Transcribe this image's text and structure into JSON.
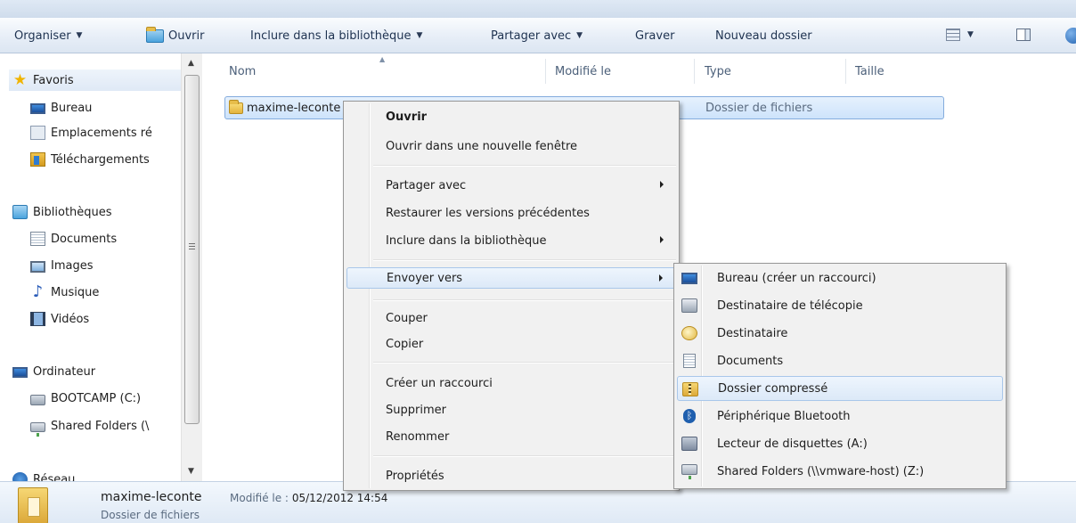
{
  "toolbar": {
    "organize": "Organiser",
    "open": "Ouvrir",
    "include_library": "Inclure dans la bibliothèque",
    "share_with": "Partager avec",
    "burn": "Graver",
    "new_folder": "Nouveau dossier"
  },
  "nav": {
    "favorites": "Favoris",
    "desktop": "Bureau",
    "recent_places": "Emplacements ré",
    "downloads": "Téléchargements",
    "libraries": "Bibliothèques",
    "documents": "Documents",
    "images": "Images",
    "music": "Musique",
    "videos": "Vidéos",
    "computer": "Ordinateur",
    "bootcamp": "BOOTCAMP (C:)",
    "shared_folders": "Shared Folders (\\",
    "network": "Réseau"
  },
  "columns": {
    "name": "Nom",
    "modified": "Modifié le",
    "type": "Type",
    "size": "Taille"
  },
  "file_row": {
    "name": "maxime-leconte",
    "type": "Dossier de fichiers"
  },
  "context_menu": {
    "open": "Ouvrir",
    "open_new_window": "Ouvrir dans une nouvelle fenêtre",
    "share_with": "Partager avec",
    "restore_versions": "Restaurer les versions précédentes",
    "include_library": "Inclure dans la bibliothèque",
    "send_to": "Envoyer vers",
    "cut": "Couper",
    "copy": "Copier",
    "create_shortcut": "Créer un raccourci",
    "delete": "Supprimer",
    "rename": "Renommer",
    "properties": "Propriétés"
  },
  "send_to_menu": {
    "desktop_shortcut": "Bureau (créer un raccourci)",
    "fax_recipient": "Destinataire de télécopie",
    "mail_recipient": "Destinataire",
    "documents": "Documents",
    "compressed_folder": "Dossier compressé",
    "bluetooth": "Périphérique Bluetooth",
    "floppy": "Lecteur de disquettes (A:)",
    "shared_folders": "Shared Folders (\\\\vmware-host) (Z:)"
  },
  "details": {
    "name": "maxime-leconte",
    "modified_label": "Modifié le :",
    "modified_value": "05/12/2012 14:54",
    "type": "Dossier de fichiers"
  }
}
